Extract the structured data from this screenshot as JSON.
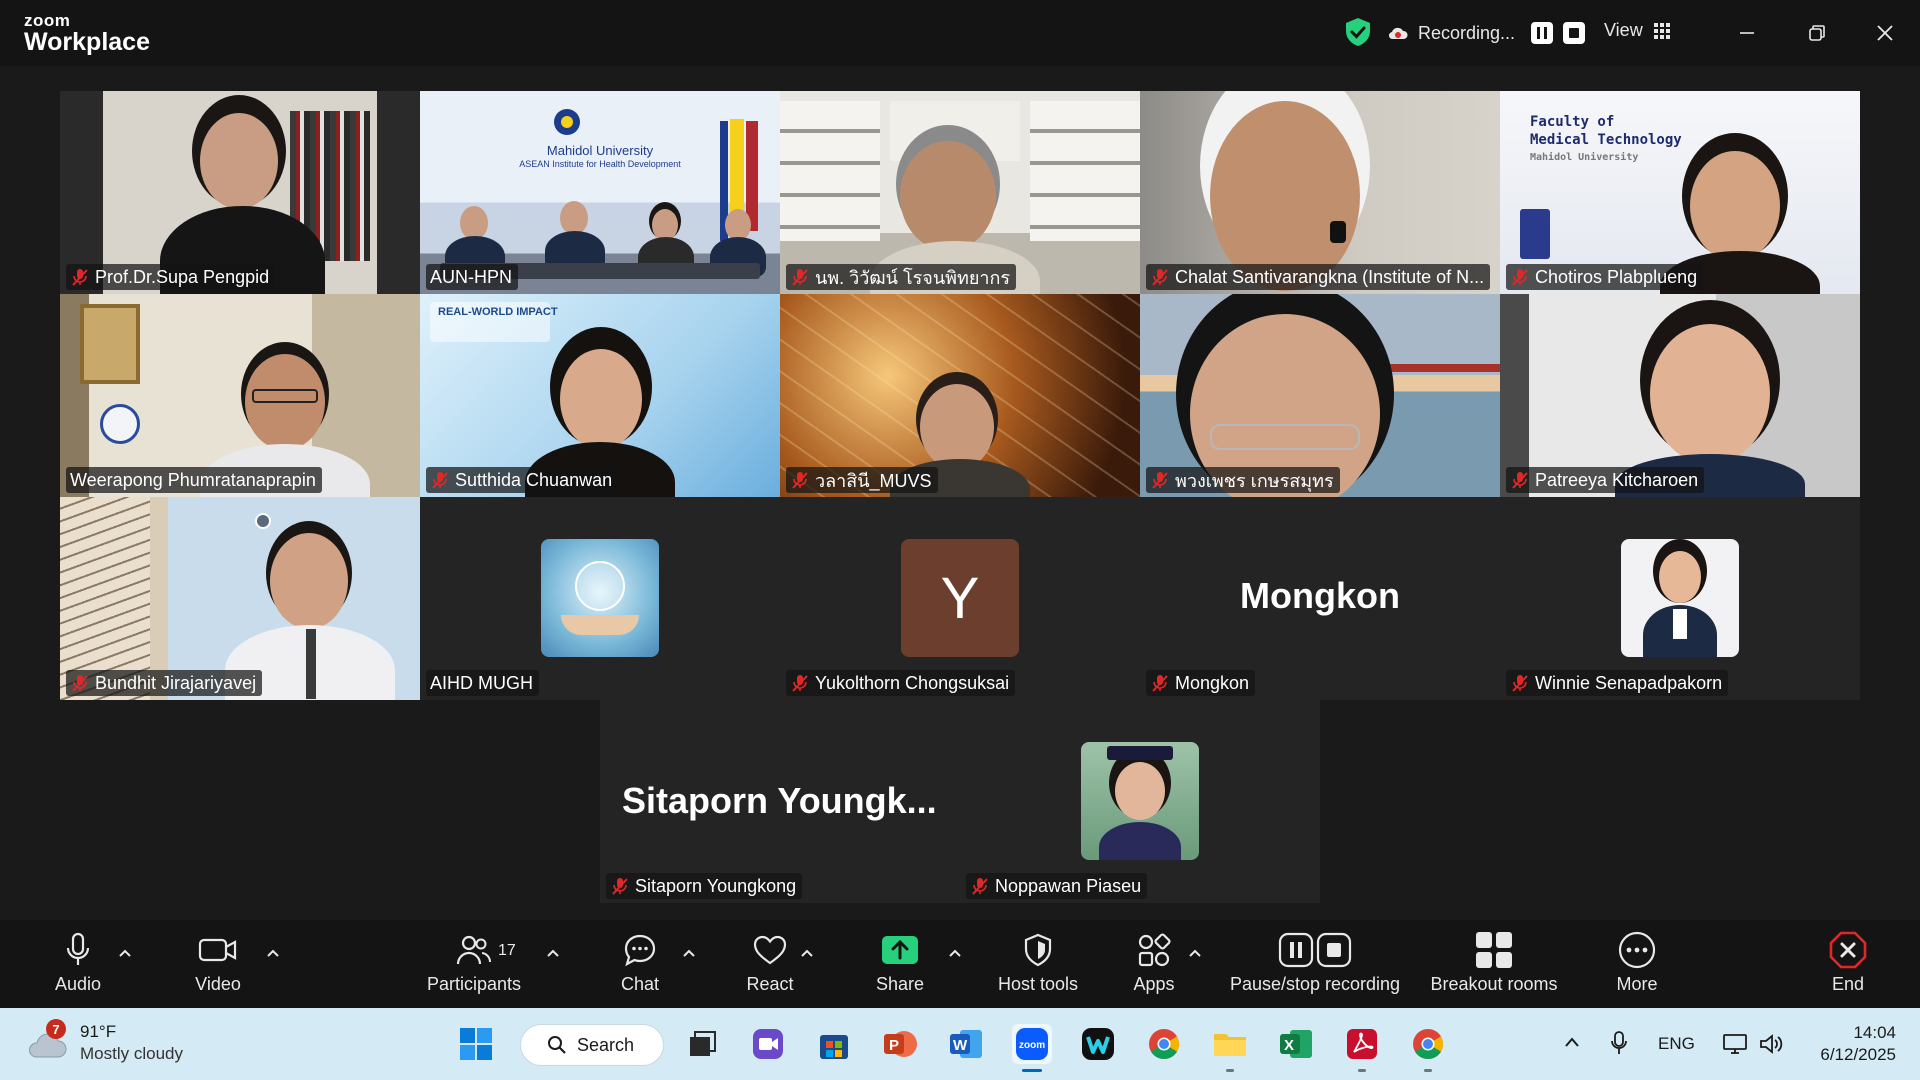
{
  "app": {
    "logo_small": "zoom",
    "logo_big": "Workplace"
  },
  "titlebar": {
    "recording_label": "Recording...",
    "view_label": "View"
  },
  "tiles": [
    {
      "name": "Prof.Dr.Supa Pengpid",
      "muted": true
    },
    {
      "name": "AUN-HPN",
      "muted": false,
      "active": true,
      "sign_line1": "Mahidol University",
      "sign_line2": "ASEAN Institute for Health Development"
    },
    {
      "name": "นพ. วิวัฒน์ โรจนพิทยากร",
      "muted": true
    },
    {
      "name": "Chalat Santivarangkna (Institute of N...",
      "muted": true
    },
    {
      "name": "Chotiros Plabplueng",
      "muted": true,
      "sign_line1": "Faculty of",
      "sign_line2": "Medical Technology",
      "sign_line3": "Mahidol University"
    },
    {
      "name": "Weerapong Phumratanaprapin",
      "muted": false
    },
    {
      "name": "Sutthida Chuanwan",
      "muted": true,
      "banner": "REAL-WORLD IMPACT"
    },
    {
      "name": "วลาสินี_MUVS",
      "muted": true
    },
    {
      "name": "พวงเพชร เกษรสมุทร",
      "muted": true
    },
    {
      "name": "Patreeya Kitcharoen",
      "muted": true
    },
    {
      "name": "Bundhit Jirajariyavej",
      "muted": true
    },
    {
      "name": "AIHD MUGH",
      "muted": false
    },
    {
      "name": "Yukolthorn Chongsuksai",
      "muted": true,
      "letter": "Y"
    },
    {
      "name": "Mongkon",
      "muted": true,
      "big_name": "Mongkon"
    },
    {
      "name": "Winnie Senapadpakorn",
      "muted": true
    },
    {
      "name": "Sitaporn Youngkong",
      "muted": true,
      "big_name": "Sitaporn  Youngk..."
    },
    {
      "name": "Noppawan Piaseu",
      "muted": true
    }
  ],
  "toolbar": {
    "audio": "Audio",
    "video": "Video",
    "participants": "Participants",
    "participants_count": "17",
    "chat": "Chat",
    "react": "React",
    "share": "Share",
    "host_tools": "Host tools",
    "apps": "Apps",
    "pause_stop": "Pause/stop recording",
    "breakout": "Breakout rooms",
    "more": "More",
    "end": "End"
  },
  "taskbar": {
    "weather_badge": "7",
    "temperature": "91°F",
    "condition": "Mostly cloudy",
    "search": "Search",
    "language": "ENG",
    "time": "14:04",
    "date": "6/12/2025"
  },
  "colors": {
    "active_speaker": "#26d07c",
    "share_green": "#26d07c",
    "end_red": "#e02828",
    "mute_red": "#e02828"
  }
}
